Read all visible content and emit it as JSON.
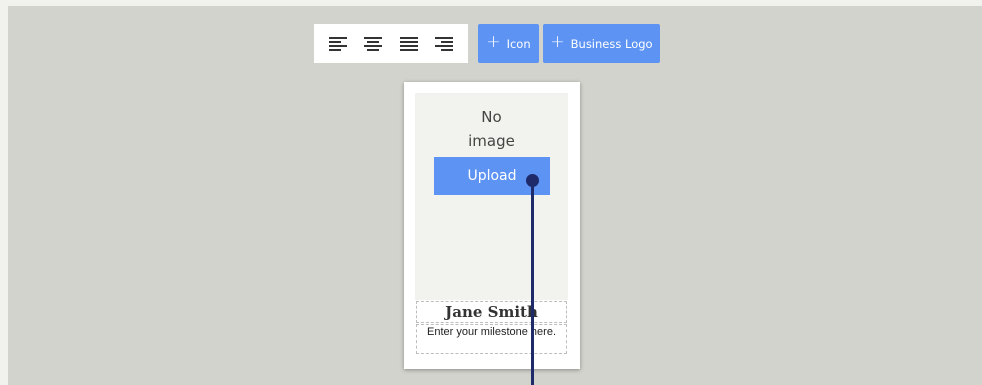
{
  "toolbar": {
    "align_buttons": [
      "align-left",
      "align-center",
      "align-justify",
      "align-right"
    ],
    "icon_button": {
      "plus": "+",
      "label": "Icon"
    },
    "logo_button": {
      "plus": "+",
      "label": "Business Logo"
    }
  },
  "card": {
    "no_image_line1": "No",
    "no_image_line2": "image",
    "upload_label": "Upload",
    "name": "Jane Smith",
    "milestone": "Enter your milestone here."
  },
  "colors": {
    "accent": "#5d93f3",
    "background": "#d3d3cd",
    "drag_line": "#1f2a6b"
  }
}
